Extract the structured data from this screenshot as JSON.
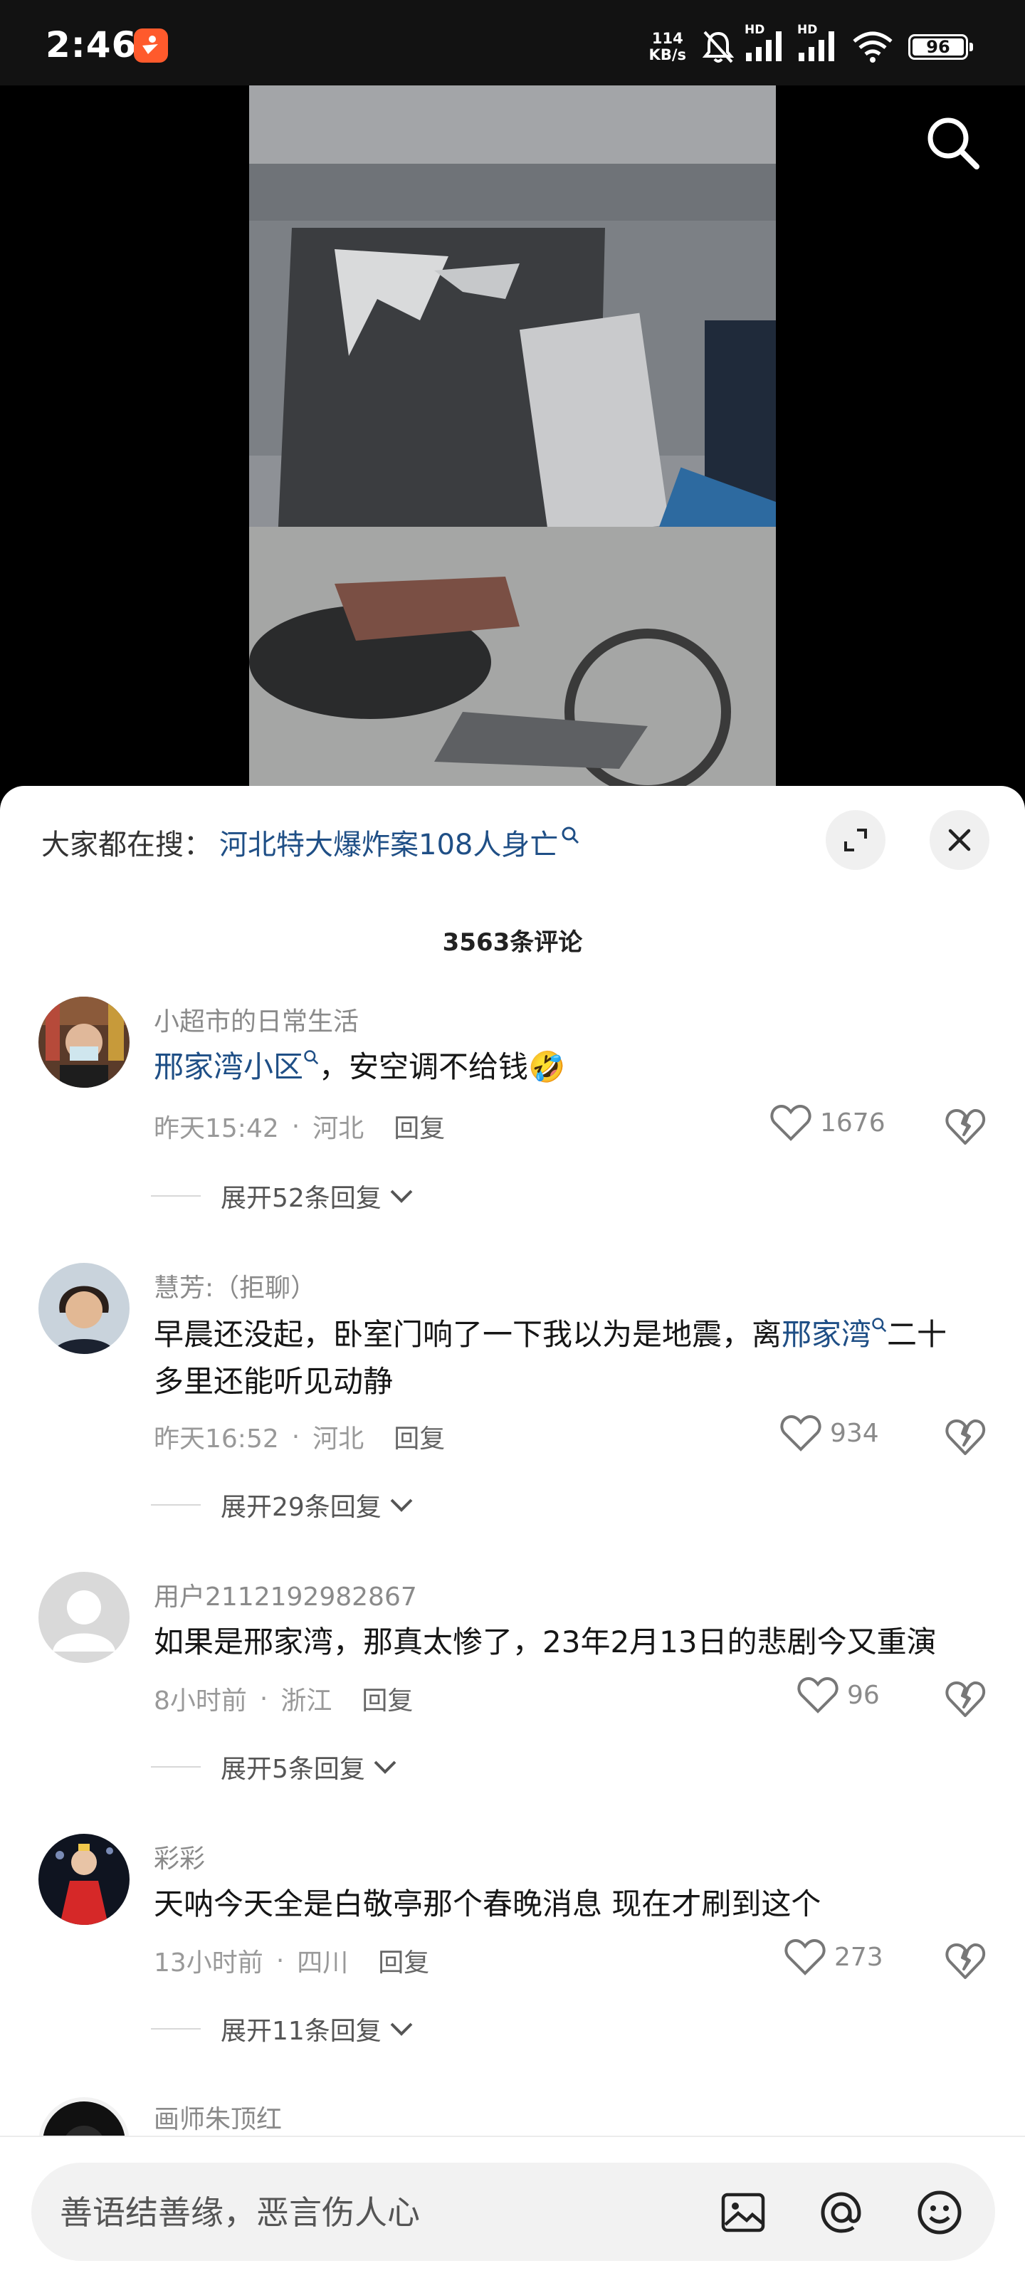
{
  "status_bar": {
    "time": "2:46",
    "net_speed_value": "114",
    "net_speed_unit": "KB/s",
    "battery": "96",
    "signal_1": "HD",
    "signal_2": "HD"
  },
  "trending": {
    "label": "大家都在搜：",
    "query": "河北特大爆炸案108人身亡"
  },
  "comment_count": "3563条评论",
  "comments": [
    {
      "name": "小超市的日常生活",
      "link": "邢家湾小区",
      "text": "，安空调不给钱🤣",
      "time": "昨天15:42",
      "location": "河北",
      "reply": "回复",
      "likes": "1676",
      "expand": "展开52条回复"
    },
    {
      "name": "慧芳:（拒聊）",
      "text_before": "早晨还没起，卧室门响了一下我以为是地震，离",
      "link": "邢家湾",
      "text_after": "二十多里还能听见动静",
      "time": "昨天16:52",
      "location": "河北",
      "reply": "回复",
      "likes": "934",
      "expand": "展开29条回复"
    },
    {
      "name": "用户2112192982867",
      "text": "如果是邢家湾，那真太惨了，23年2月13日的悲剧今又重演",
      "time": "8小时前",
      "location": "浙江",
      "reply": "回复",
      "likes": "96",
      "expand": "展开5条回复"
    },
    {
      "name": "彩彩",
      "text": "天呐今天全是白敬亭那个春晚消息 现在才刷到这个",
      "time": "13小时前",
      "location": "四川",
      "reply": "回复",
      "likes": "273",
      "expand": "展开11条回复"
    },
    {
      "name": "画师朱顶红"
    }
  ],
  "input": {
    "placeholder": "善语结善缘，恶言伤人心"
  },
  "colors": {
    "link": "#1f4f86",
    "status_bar_bg": "#121212",
    "sheet_bg": "#ffffff"
  },
  "icons": [
    "app-badge-icon",
    "mute-icon",
    "signal-icon",
    "wifi-icon",
    "battery-icon",
    "search-icon",
    "expand-icon",
    "close-icon",
    "like-icon",
    "dislike-icon",
    "chevron-down-icon",
    "image-icon",
    "at-icon",
    "emoji-icon"
  ]
}
